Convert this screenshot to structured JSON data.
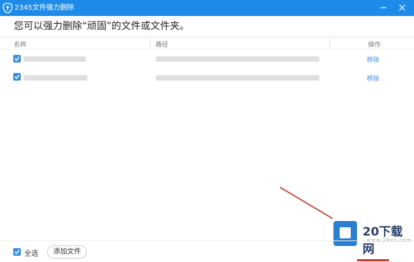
{
  "window": {
    "title": "2345文件强力删除"
  },
  "subtitle": "您可以强力删除“顽固”的文件或文件夹。",
  "table": {
    "columns": [
      "名称",
      "路径",
      "操作"
    ],
    "rows": [
      {
        "checked": true,
        "action": "移除"
      },
      {
        "checked": true,
        "action": "移除"
      }
    ]
  },
  "footer": {
    "select_all_label": "全选",
    "add_file_label": "添加文件"
  },
  "watermark": {
    "brand": "20下载网",
    "url": "www.20xz.com"
  },
  "colors": {
    "titlebar": "#1f8be8",
    "accent": "#3b8fe0"
  }
}
